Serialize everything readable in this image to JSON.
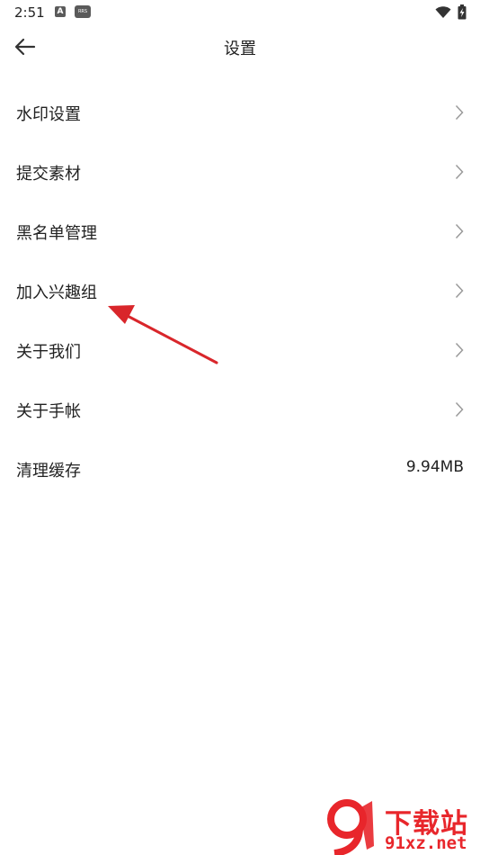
{
  "status_bar": {
    "time": "2:51",
    "a_icon_label": "A",
    "app_icon_label": "RRS"
  },
  "header": {
    "title": "设置"
  },
  "settings": {
    "items": [
      {
        "label": "水印设置"
      },
      {
        "label": "提交素材"
      },
      {
        "label": "黑名单管理"
      },
      {
        "label": "加入兴趣组"
      },
      {
        "label": "关于我们"
      },
      {
        "label": "关于手帐"
      },
      {
        "label": "清理缓存",
        "value": "9.94MB"
      }
    ]
  },
  "annotation": {
    "color": "#d9262b",
    "target": "加入兴趣组"
  },
  "watermark": {
    "brand_cn": "下载站",
    "url": "91xz.net",
    "color": "#e8262b"
  },
  "colors": {
    "text": "#222222",
    "chevron": "#9a9a9a",
    "background": "#ffffff"
  }
}
